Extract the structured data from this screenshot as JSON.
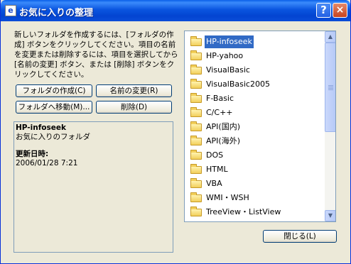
{
  "title": "お気に入りの整理",
  "title_icon": "favorites-icon",
  "title_buttons": {
    "help": "?",
    "close": "×"
  },
  "description": "新しいフォルダを作成するには、[フォルダの作成] ボタンをクリックしてください。項目の名前を変更または削除するには、項目を選択してから [名前の変更] ボタン、または [削除] ボタンをクリックしてください。",
  "buttons": {
    "create_folder": "フォルダの作成(C)",
    "rename": "名前の変更(R)",
    "move_to_folder": "フォルダへ移動(M)...",
    "delete": "削除(D)",
    "close": "閉じる(L)"
  },
  "info": {
    "name": "HP-infoseek",
    "type": "お気に入りのフォルダ",
    "updated_label": "更新日時:",
    "updated_value": "2006/01/28 7:21"
  },
  "folders": [
    "HP-infoseek",
    "HP-yahoo",
    "VisualBasic",
    "VisualBasic2005",
    "F-Basic",
    "C/C++",
    "API(国内)",
    "API(海外)",
    "DOS",
    "HTML",
    "VBA",
    "WMI・WSH",
    "TreeView・ListView"
  ],
  "selected_index": 0,
  "colors": {
    "selection": "#316ac5",
    "titlebar": "#0a55df",
    "dialog_bg": "#ece9d8"
  }
}
